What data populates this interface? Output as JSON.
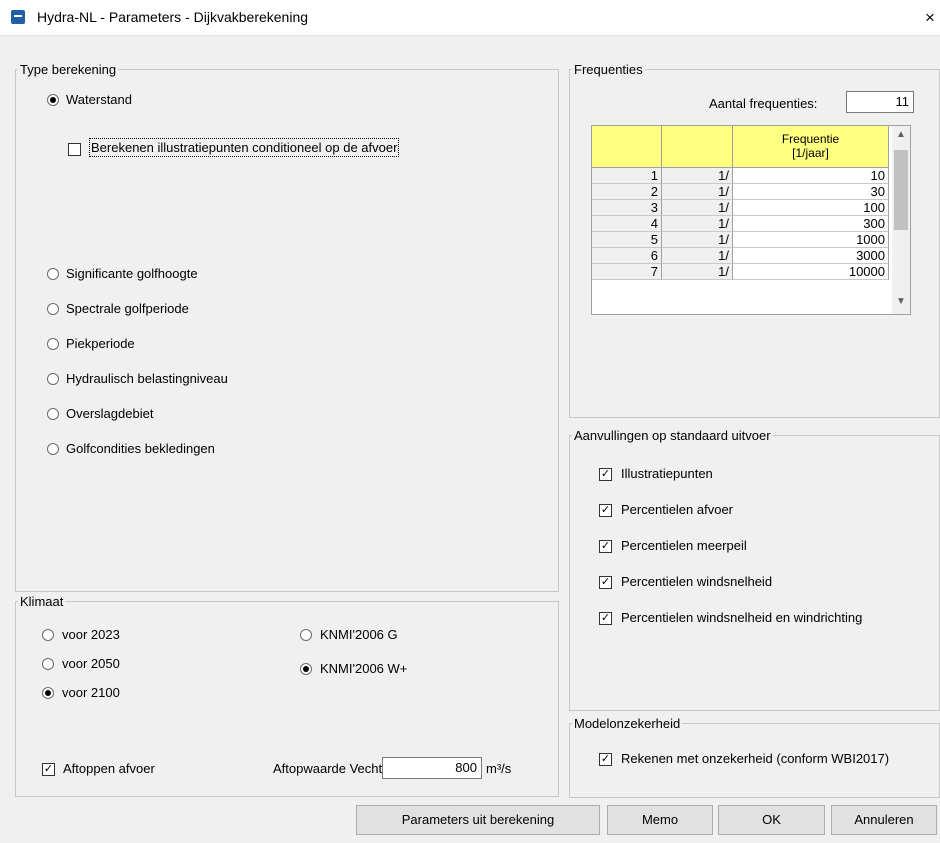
{
  "window": {
    "title": "Hydra-NL - Parameters - Dijkvakberekening",
    "close": "×"
  },
  "type_berekening": {
    "legend": "Type berekening",
    "waterstand": "Waterstand",
    "illustratie_conditioneel": "Berekenen illustratiepunten conditioneel op de afvoer",
    "significante": "Significante golfhoogte",
    "spectrale": "Spectrale golfperiode",
    "piek": "Piekperiode",
    "hydraulisch": "Hydraulisch belastingniveau",
    "overslag": "Overslagdebiet",
    "golfcondities": "Golfcondities bekledingen",
    "selected": "Waterstand"
  },
  "frequenties": {
    "legend": "Frequenties",
    "aantal_label": "Aantal frequenties:",
    "aantal_value": "11",
    "column_header": "Frequentie [1/jaar]",
    "rows": [
      {
        "n": "1",
        "p": "1/",
        "v": "10"
      },
      {
        "n": "2",
        "p": "1/",
        "v": "30"
      },
      {
        "n": "3",
        "p": "1/",
        "v": "100"
      },
      {
        "n": "4",
        "p": "1/",
        "v": "300"
      },
      {
        "n": "5",
        "p": "1/",
        "v": "1000"
      },
      {
        "n": "6",
        "p": "1/",
        "v": "3000"
      },
      {
        "n": "7",
        "p": "1/",
        "v": "10000"
      }
    ]
  },
  "aanvullingen": {
    "legend": "Aanvullingen op standaard uitvoer",
    "items": [
      {
        "label": "Illustratiepunten",
        "checked": true
      },
      {
        "label": "Percentielen afvoer",
        "checked": true
      },
      {
        "label": "Percentielen meerpeil",
        "checked": true
      },
      {
        "label": "Percentielen windsnelheid",
        "checked": true
      },
      {
        "label": "Percentielen windsnelheid en windrichting",
        "checked": true
      }
    ]
  },
  "klimaat": {
    "legend": "Klimaat",
    "voor_2023": "voor 2023",
    "voor_2050": "voor 2050",
    "voor_2100": "voor 2100",
    "knmi_g": "KNMI'2006 G",
    "knmi_w": "KNMI'2006 W+",
    "selected_year": "voor 2100",
    "selected_scenario": "KNMI'2006 W+",
    "aftoppen_label": "Aftoppen afvoer",
    "aftoppen_checked": true,
    "aftopwaarde_label": "Aftopwaarde Vecht:",
    "aftopwaarde_value": "800",
    "unit": "m³/s"
  },
  "modelonzekerheid": {
    "legend": "Modelonzekerheid",
    "rekenen_label": "Rekenen met onzekerheid (conform WBI2017)",
    "checked": true
  },
  "buttons": {
    "parameters": "Parameters uit berekening",
    "memo": "Memo",
    "ok": "OK",
    "annuleren": "Annuleren"
  }
}
